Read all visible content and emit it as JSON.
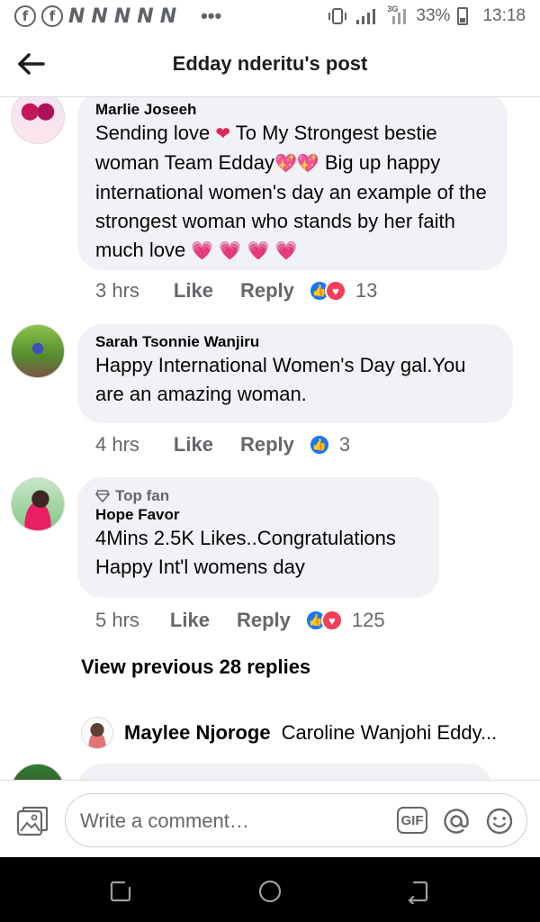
{
  "status_bar": {
    "network": "3G",
    "battery": "33%",
    "time": "13:18"
  },
  "header": {
    "title": "Edday nderitu's post"
  },
  "comments": [
    {
      "author": "Marlie Joseeh",
      "text_parts": [
        "Sending love ",
        " To My Strongest bestie woman Team Edday",
        " Big up happy international women's day an example of the strongest woman who stands by her faith much love "
      ],
      "time": "3 hrs",
      "like_label": "Like",
      "reply_label": "Reply",
      "reaction_count": "13"
    },
    {
      "author": "Sarah Tsonnie Wanjiru",
      "text": "Happy International Women's Day gal.You are an amazing woman.",
      "time": "4 hrs",
      "like_label": "Like",
      "reply_label": "Reply",
      "reaction_count": "3"
    },
    {
      "badge": "Top fan",
      "author": "Hope Favor",
      "text": "4Mins 2.5K Likes..Congratulations Happy Int'l womens day",
      "time": "5 hrs",
      "like_label": "Like",
      "reply_label": "Reply",
      "reaction_count": "125"
    }
  ],
  "view_previous": "View previous 28 replies",
  "latest_reply": {
    "author": "Maylee Njoroge",
    "text": "Caroline Wanjohi Eddy..."
  },
  "composer": {
    "placeholder": "Write a comment…",
    "gif_label": "GIF"
  },
  "colors": {
    "bubble": "#f0f2f5",
    "like_blue": "#1877f2",
    "love_red": "#f33e58",
    "secondary_text": "#65676b"
  }
}
